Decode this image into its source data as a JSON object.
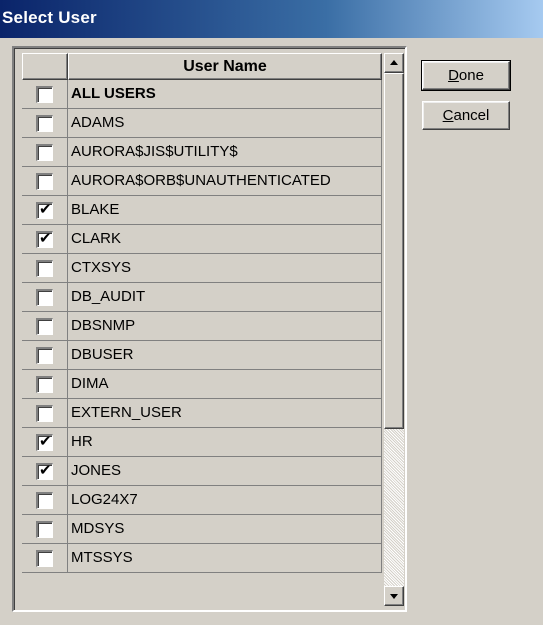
{
  "window": {
    "title": "Select User"
  },
  "grid": {
    "column_header": "User Name",
    "rows": [
      {
        "name": "ALL USERS",
        "checked": false,
        "bold": true
      },
      {
        "name": "ADAMS",
        "checked": false
      },
      {
        "name": "AURORA$JIS$UTILITY$",
        "checked": false
      },
      {
        "name": "AURORA$ORB$UNAUTHENTICATED",
        "checked": false
      },
      {
        "name": "BLAKE",
        "checked": true
      },
      {
        "name": "CLARK",
        "checked": true
      },
      {
        "name": "CTXSYS",
        "checked": false
      },
      {
        "name": "DB_AUDIT",
        "checked": false
      },
      {
        "name": "DBSNMP",
        "checked": false
      },
      {
        "name": "DBUSER",
        "checked": false
      },
      {
        "name": "DIMA",
        "checked": false
      },
      {
        "name": "EXTERN_USER",
        "checked": false
      },
      {
        "name": "HR",
        "checked": true
      },
      {
        "name": "JONES",
        "checked": true
      },
      {
        "name": "LOG24X7",
        "checked": false
      },
      {
        "name": "MDSYS",
        "checked": false
      },
      {
        "name": "MTSSYS",
        "checked": false
      }
    ]
  },
  "buttons": {
    "done": {
      "accel": "D",
      "rest": "one"
    },
    "cancel": {
      "accel": "C",
      "rest": "ancel"
    }
  },
  "icons": {
    "scroll_up": "scroll-up-arrow-icon",
    "scroll_down": "scroll-down-arrow-icon",
    "check": "checkmark-icon"
  },
  "colors": {
    "titlebar_start": "#0a246a",
    "titlebar_end": "#a6caf0",
    "face": "#d4d0c8"
  }
}
